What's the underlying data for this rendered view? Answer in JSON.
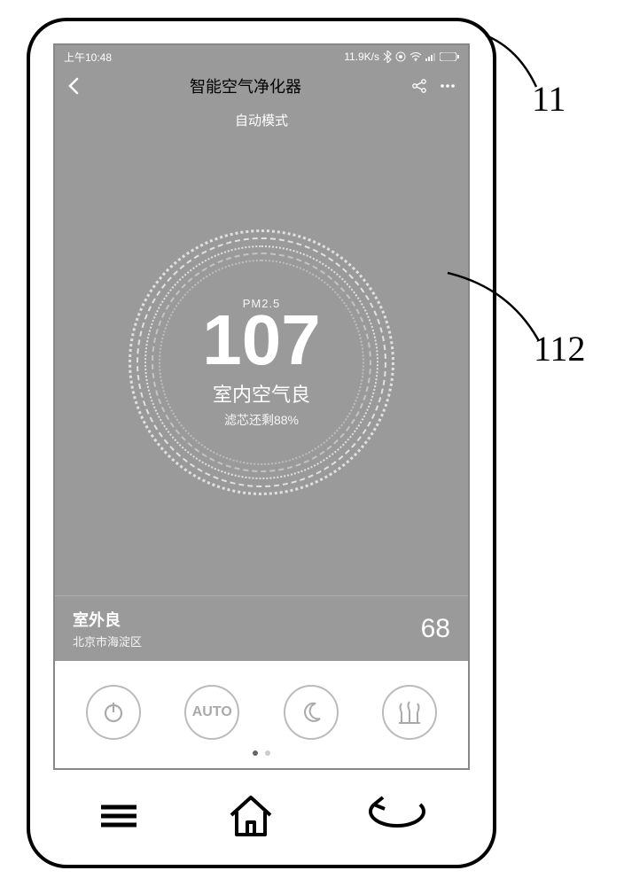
{
  "statusBar": {
    "time": "上午10:48",
    "speed": "11.9K/s"
  },
  "titleBar": {
    "title": "智能空气净化器"
  },
  "modeLabel": "自动模式",
  "circle": {
    "pmLabel": "PM2.5",
    "pmValue": "107",
    "airQuality": "室内空气良",
    "filter": "滤芯还剩88%"
  },
  "outdoor": {
    "quality": "室外良",
    "location": "北京市海淀区",
    "value": "68"
  },
  "controls": {
    "power": "",
    "auto": "AUTO",
    "night": "",
    "favorite": ""
  },
  "callouts": {
    "frame": "11",
    "screen": "112"
  }
}
